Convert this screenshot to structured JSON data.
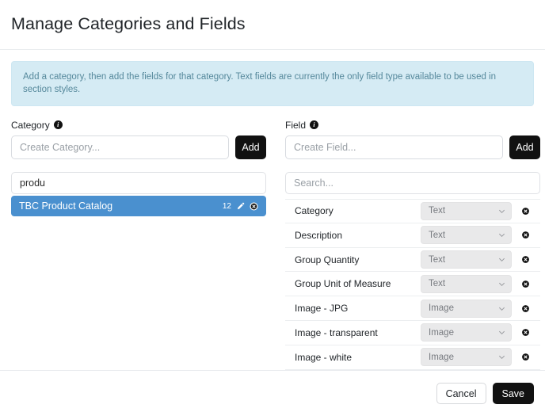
{
  "header": {
    "title": "Manage Categories and Fields"
  },
  "alert": {
    "text": "Add a category, then add the fields for that category. Text fields are currently the only field type available to be used in section styles.",
    "bg_color": "#d5ebf4",
    "text_color": "#55889b"
  },
  "category_panel": {
    "label": "Category",
    "info_icon": "info-icon",
    "info_glyph": "i",
    "create_placeholder": "Create Category...",
    "create_value": "",
    "add_label": "Add",
    "filter_value": "produ",
    "filter_placeholder": "",
    "selected_color": "#4a90cf",
    "items": [
      {
        "name": "TBC Product Catalog",
        "count": "12",
        "selected": true,
        "edit_icon": "pencil-icon",
        "delete_icon": "remove-circle-icon"
      }
    ]
  },
  "field_panel": {
    "label": "Field",
    "info_icon": "info-icon",
    "info_glyph": "i",
    "create_placeholder": "Create Field...",
    "create_value": "",
    "add_label": "Add",
    "search_placeholder": "Search...",
    "search_value": "",
    "type_options": [
      "Text",
      "Image"
    ],
    "rows": [
      {
        "name": "Category",
        "type": "Text"
      },
      {
        "name": "Description",
        "type": "Text"
      },
      {
        "name": "Group Quantity",
        "type": "Text"
      },
      {
        "name": "Group Unit of Measure",
        "type": "Text"
      },
      {
        "name": "Image - JPG",
        "type": "Image"
      },
      {
        "name": "Image - transparent",
        "type": "Image"
      },
      {
        "name": "Image - white",
        "type": "Image"
      },
      {
        "name": "",
        "type": ""
      }
    ]
  },
  "footer": {
    "cancel_label": "Cancel",
    "save_label": "Save"
  }
}
